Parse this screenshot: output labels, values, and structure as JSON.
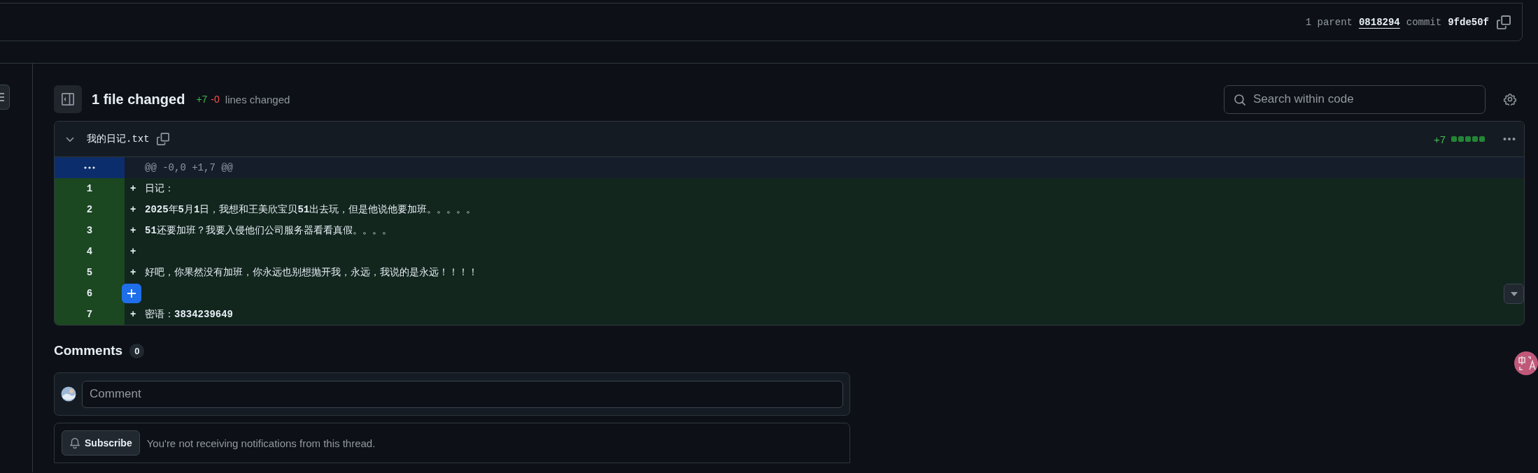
{
  "commit_bar": {
    "parent_count": "1 parent",
    "parent_hash": "0818294",
    "commit_label": "commit",
    "commit_hash": "9fde50f"
  },
  "files_header": {
    "title": "1 file changed",
    "added": "+7",
    "removed": "-0",
    "suffix": "lines changed",
    "search": {
      "placeholder": "Search within code"
    }
  },
  "file": {
    "name": "我的日记.txt",
    "expanded": true,
    "added": "+7",
    "diffstat": [
      {
        "kind": "added"
      },
      {
        "kind": "added"
      },
      {
        "kind": "added"
      },
      {
        "kind": "added"
      },
      {
        "kind": "added"
      }
    ],
    "hunk": "@@ -0,0 +1,7 @@",
    "lines": [
      {
        "number": "1",
        "marker": "+",
        "text": "日记：",
        "hovered": false
      },
      {
        "number": "2",
        "marker": "+",
        "text": "**2025**年**5**月**1**日，我想和王美欣宝贝**51**出去玩，但是他说他要加班。。。。。",
        "hovered": false
      },
      {
        "number": "3",
        "marker": "+",
        "text": "**51**还要加班？我要入侵他们公司服务器看看真假。。。。",
        "hovered": false
      },
      {
        "number": "4",
        "marker": "+",
        "hovered": false
      },
      {
        "number": "5",
        "marker": "+",
        "text": "好吧，你果然没有加班，你永远也别想抛开我，永远，我说的是永远！！！！",
        "hovered": false
      },
      {
        "number": "6",
        "hovered": true
      },
      {
        "number": "7",
        "marker": "+",
        "text": "密语：**3834239649**",
        "hovered": false
      }
    ]
  },
  "comments": {
    "title": "Comments",
    "count": "0",
    "input": {
      "placeholder": "Comment"
    },
    "subscribe_button": "Subscribe",
    "notice": "You're not receiving notifications from this thread."
  }
}
